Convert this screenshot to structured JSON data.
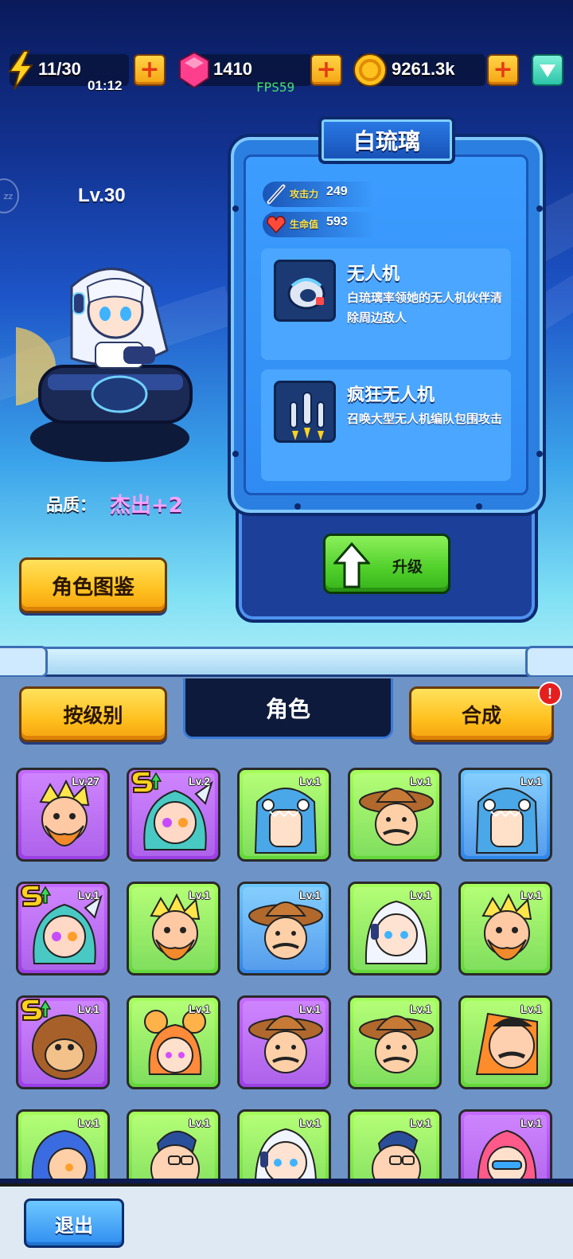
{
  "resources": {
    "energy": "11/30",
    "energy_timer": "01:12",
    "gems": "1410",
    "coins": "9261.3k",
    "fps": "FPS59"
  },
  "hero": {
    "level": "Lv.30",
    "name": "白琉璃",
    "quality_label": "品质：",
    "quality_value": "杰出+2",
    "stats": {
      "attack_label": "攻击力",
      "attack_value": "249",
      "hp_label": "生命值",
      "hp_value": "593"
    },
    "skills": [
      {
        "name": "无人机",
        "desc": "白琉璃率领她的无人机伙伴清除周边敌人",
        "icon": "drone-icon"
      },
      {
        "name": "疯狂无人机",
        "desc": "召唤大型无人机编队包围攻击",
        "icon": "drone-swarm-icon"
      }
    ],
    "upgrade_label": "升级",
    "codex_label": "角色图鉴"
  },
  "tabs": {
    "by_level": "按级别",
    "roles": "角色",
    "merge": "合成",
    "merge_alert": "!"
  },
  "roster": [
    {
      "level": "Lv.27",
      "rarity": "purple",
      "face": "bearded-hero",
      "star_up": false
    },
    {
      "level": "Lv.2",
      "rarity": "purple",
      "face": "teal-girl",
      "star_up": true
    },
    {
      "level": "Lv.1",
      "rarity": "green",
      "face": "shark-hood",
      "star_up": false
    },
    {
      "level": "Lv.1",
      "rarity": "green",
      "face": "cowboy",
      "star_up": false
    },
    {
      "level": "Lv.1",
      "rarity": "blue",
      "face": "shark-hood",
      "star_up": false
    },
    {
      "level": "Lv.1",
      "rarity": "purple",
      "face": "teal-girl",
      "star_up": true
    },
    {
      "level": "Lv.1",
      "rarity": "green",
      "face": "bearded-hero",
      "star_up": false
    },
    {
      "level": "Lv.1",
      "rarity": "blue",
      "face": "cowboy",
      "star_up": false
    },
    {
      "level": "Lv.1",
      "rarity": "green",
      "face": "white-hair-girl",
      "star_up": false
    },
    {
      "level": "Lv.1",
      "rarity": "green",
      "face": "bearded-hero",
      "star_up": false
    },
    {
      "level": "Lv.1",
      "rarity": "purple",
      "face": "monkey",
      "star_up": true
    },
    {
      "level": "Lv.1",
      "rarity": "green",
      "face": "bun-girl",
      "star_up": false
    },
    {
      "level": "Lv.1",
      "rarity": "purple",
      "face": "cowboy",
      "star_up": false
    },
    {
      "level": "Lv.1",
      "rarity": "green",
      "face": "cowboy",
      "star_up": false
    },
    {
      "level": "Lv.1",
      "rarity": "green",
      "face": "mustache-man",
      "star_up": false
    },
    {
      "level": "Lv.1",
      "rarity": "green",
      "face": "blue-hair-boy",
      "star_up": false
    },
    {
      "level": "Lv.1",
      "rarity": "green",
      "face": "glasses-man",
      "star_up": false
    },
    {
      "level": "Lv.1",
      "rarity": "green",
      "face": "white-hair-girl",
      "star_up": false
    },
    {
      "level": "Lv.1",
      "rarity": "green",
      "face": "glasses-man",
      "star_up": false
    },
    {
      "level": "Lv.1",
      "rarity": "purple",
      "face": "pink-hair-girl",
      "star_up": false
    }
  ],
  "bottom": {
    "exit_label": "退出"
  },
  "colors": {
    "purple": "#9b3fe6",
    "green": "#63d63a",
    "blue": "#2f86e8",
    "accent_yellow": "#ffc01f"
  }
}
